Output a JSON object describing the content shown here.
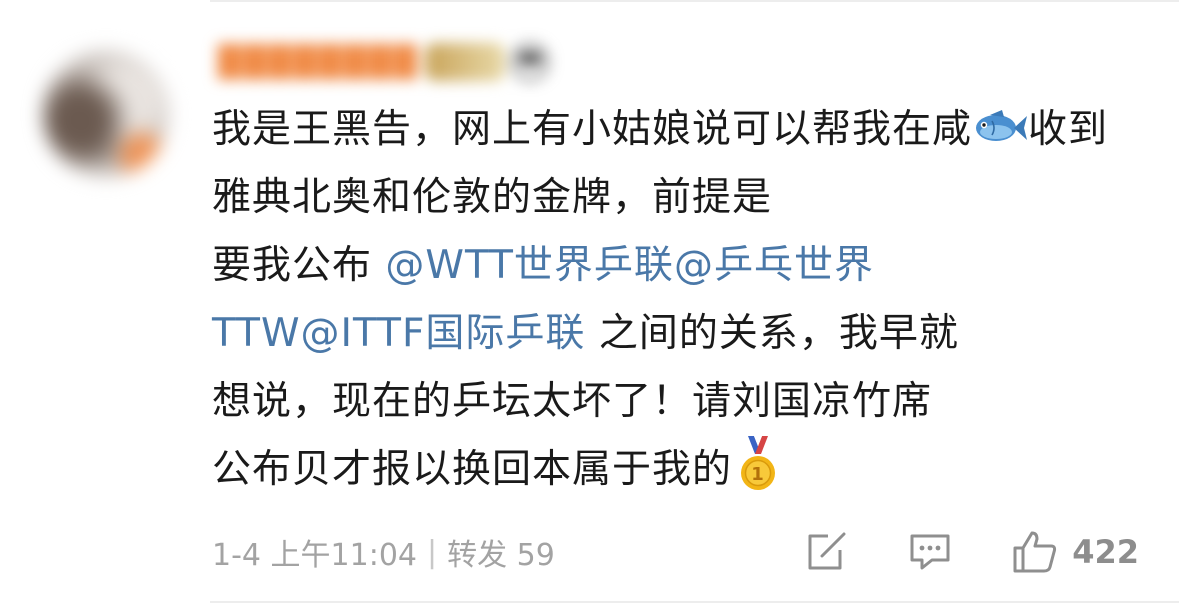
{
  "comment": {
    "author": {
      "name": "",
      "avatar_icon": "user-avatar"
    },
    "segments": [
      {
        "type": "text",
        "text": "我是王黑告，网上有小姑娘说可以帮我在咸"
      },
      {
        "type": "icon",
        "icon": "fish-emoji"
      },
      {
        "type": "text",
        "text": "收到雅典北奥和伦敦的金牌，前提是要我公布 "
      },
      {
        "type": "mention",
        "text": "@WTT世界乒联"
      },
      {
        "type": "mention",
        "text": "@乒乓世界TTW"
      },
      {
        "type": "mention",
        "text": "@ITTF国际乒联"
      },
      {
        "type": "text",
        "text": " 之间的关系，我早就想说，现在的乒坛太坏了！请刘国凉竹席公布贝才报以换回本属于我的"
      },
      {
        "type": "icon",
        "icon": "gold-medal-emoji"
      }
    ],
    "text_part1": "我是王黑告，网上有小姑娘说可以帮我在",
    "text_part2": "咸",
    "text_part3": "收到雅典北奥和伦敦的金牌，前提是",
    "text_part4": "要我公布 ",
    "mention1": "@WTT世界乒联",
    "mention2": "@乒乓世界",
    "mention2b": "TTW",
    "mention3": "@ITTF国际乒联",
    "text_part5": " 之间的关系，我早就",
    "text_part6": "想说，现在的乒坛太坏了！请刘国凉竹席",
    "text_part7": "公布贝才报以换回本属于我的",
    "footer": {
      "time": "1-4 上午11:04",
      "separator": "|",
      "repost_label": "转发",
      "repost_count": "59",
      "like_count": "422"
    }
  },
  "colors": {
    "text": "#1a1a1a",
    "mention": "#4a78a8",
    "meta": "#a3a3a3",
    "divider": "#ededed"
  },
  "icons": [
    "fish-emoji",
    "gold-medal-emoji",
    "edit-icon",
    "comment-icon",
    "thumbs-up-icon"
  ]
}
